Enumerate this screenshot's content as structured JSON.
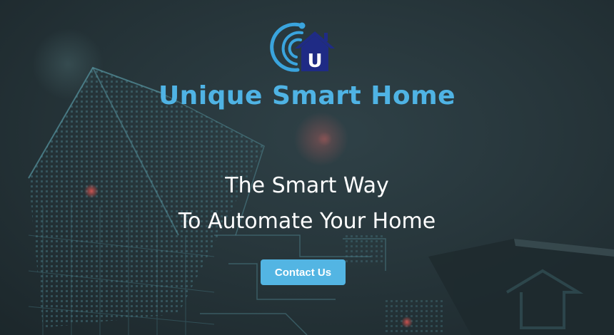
{
  "brand": {
    "name": "Unique Smart Home",
    "logo_icon": "smart-home-logo-icon",
    "logo_letter": "U",
    "color": "#4fb3e4",
    "logo_color": "#1f2b85"
  },
  "hero": {
    "tagline_line1": "The Smart Way",
    "tagline_line2": "To Automate Your Home",
    "background_icon": "circuit-house-background"
  },
  "cta": {
    "label": "Contact Us",
    "color": "#53b5e3"
  }
}
